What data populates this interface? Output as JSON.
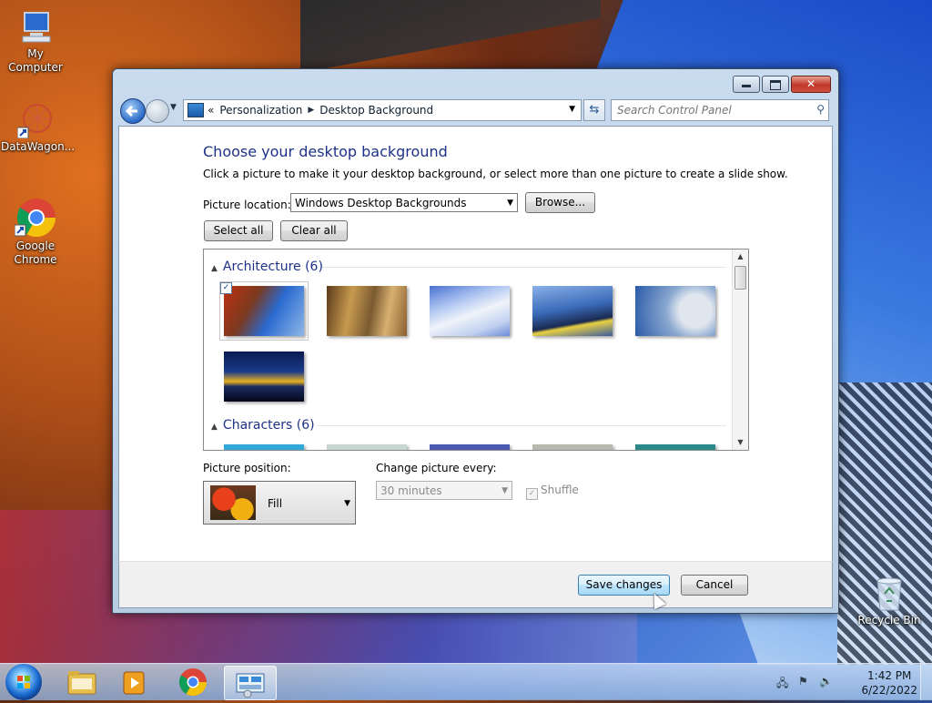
{
  "desktop": {
    "icons": [
      {
        "label": "My Computer"
      },
      {
        "label": "DataWagon..."
      },
      {
        "label": "Google Chrome"
      },
      {
        "label": "Recycle Bin"
      }
    ]
  },
  "window": {
    "breadcrumb": {
      "root": "«",
      "item1": "Personalization",
      "item2": "Desktop Background"
    },
    "search_placeholder": "Search Control Panel",
    "heading": "Choose your desktop background",
    "description": "Click a picture to make it your desktop background, or select more than one picture to create a slide show.",
    "picture_location_label": "Picture location:",
    "picture_location_value": "Windows Desktop Backgrounds",
    "browse_label": "Browse...",
    "select_all_label": "Select all",
    "clear_all_label": "Clear all",
    "groups": [
      {
        "name": "Architecture (6)"
      },
      {
        "name": "Characters (6)"
      }
    ],
    "picture_position_label": "Picture position:",
    "picture_position_value": "Fill",
    "change_every_label": "Change picture every:",
    "change_every_value": "30 minutes",
    "shuffle_label": "Shuffle",
    "save_label": "Save changes",
    "cancel_label": "Cancel"
  },
  "taskbar": {
    "time": "1:42 PM",
    "date": "6/22/2022"
  }
}
